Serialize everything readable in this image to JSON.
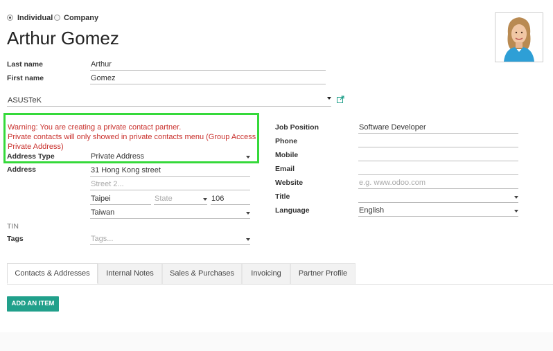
{
  "partner_type": {
    "individual_label": "Individual",
    "company_label": "Company",
    "selected": "Individual"
  },
  "title": "Arthur Gomez",
  "names": {
    "last_name_label": "Last name",
    "last_name_value": "Arthur",
    "first_name_label": "First name",
    "first_name_value": "Gomez"
  },
  "company": {
    "value": "ASUSTeK"
  },
  "warning": {
    "line1": "Warning: You are creating a private contact partner.",
    "line2": "Private contacts will only showed in private contacts menu (Group Access",
    "line3": "Private Address)"
  },
  "address_type": {
    "label": "Address Type",
    "value": "Private Address"
  },
  "address": {
    "label": "Address",
    "street": "31 Hong Kong street",
    "street2_placeholder": "Street 2...",
    "city": "Taipei",
    "state_placeholder": "State",
    "zip": "106",
    "country": "Taiwan"
  },
  "tin": {
    "label": "TIN"
  },
  "tags": {
    "label": "Tags",
    "placeholder": "Tags..."
  },
  "right_fields": {
    "job_position_label": "Job Position",
    "job_position_value": "Software Developer",
    "phone_label": "Phone",
    "mobile_label": "Mobile",
    "email_label": "Email",
    "website_label": "Website",
    "website_placeholder": "e.g. www.odoo.com",
    "title_label": "Title",
    "language_label": "Language",
    "language_value": "English"
  },
  "tabs": [
    {
      "label": "Contacts & Addresses",
      "active": true
    },
    {
      "label": "Internal Notes",
      "active": false
    },
    {
      "label": "Sales & Purchases",
      "active": false
    },
    {
      "label": "Invoicing",
      "active": false
    },
    {
      "label": "Partner Profile",
      "active": false
    }
  ],
  "actions": {
    "add_item_label": "ADD AN ITEM"
  },
  "colors": {
    "accent": "#21a08b",
    "warning_text": "#c9302c",
    "highlight_border": "#35d93a"
  },
  "icons": {
    "external_link": "external-link-icon",
    "dropdown": "chevron-down-icon",
    "avatar": "avatar"
  }
}
